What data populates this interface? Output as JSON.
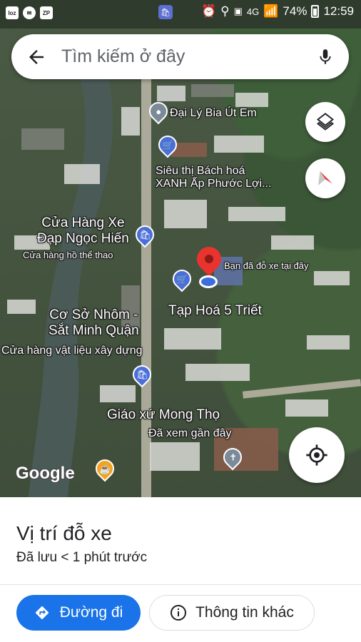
{
  "status_bar": {
    "left_icons": [
      "loz",
      "messenger",
      "ZP"
    ],
    "network": "4G",
    "battery": "74%",
    "time": "12:59"
  },
  "search": {
    "placeholder": "Tìm kiếm ở đây"
  },
  "map": {
    "labels": {
      "dai_ly_bia": "Đại Lý Bia Út Em",
      "sieu_thi_line1": "Siêu thị Bách hoá",
      "sieu_thi_line2": "XANH Ấp Phước Lợi...",
      "cua_hang_xe_line1": "Cửa Hàng Xe",
      "cua_hang_xe_line2": "Đạp Ngọc Hiến",
      "cua_hang_xe_sub": "Cửa hàng hồ thể thao",
      "parked_here": "Bạn đã đỗ xe tại đây",
      "tap_hoa": "Tạp Hoá 5 Triết",
      "nhom_line1": "Cơ Sở Nhôm -",
      "nhom_line2": "Sắt Minh Quận",
      "nhom_sub": "Cửa hàng vật liệu xây dựng",
      "giao_xu": "Giáo xứ Mong Thọ",
      "giao_xu_sub": "Đã xem gần đây",
      "google": "Google"
    }
  },
  "sheet": {
    "title": "Vị trí đỗ xe",
    "subtitle": "Đã lưu < 1 phút trước",
    "directions_label": "Đường đi",
    "more_info_label": "Thông tin khác"
  },
  "colors": {
    "accent": "#1a73e8",
    "parking_pin": "#e8332f"
  }
}
